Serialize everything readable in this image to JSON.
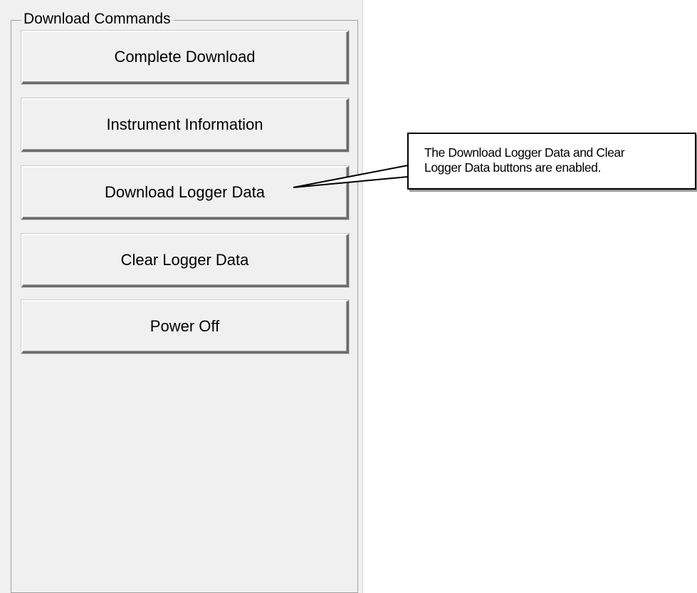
{
  "group": {
    "title": "Download Commands"
  },
  "buttons": [
    {
      "label": "Complete Download"
    },
    {
      "label": "Instrument Information"
    },
    {
      "label": "Download Logger Data"
    },
    {
      "label": "Clear Logger Data"
    },
    {
      "label": "Power Off"
    }
  ],
  "callout": {
    "line1": "The Download Logger Data and Clear",
    "line2": "Logger Data buttons are enabled."
  }
}
